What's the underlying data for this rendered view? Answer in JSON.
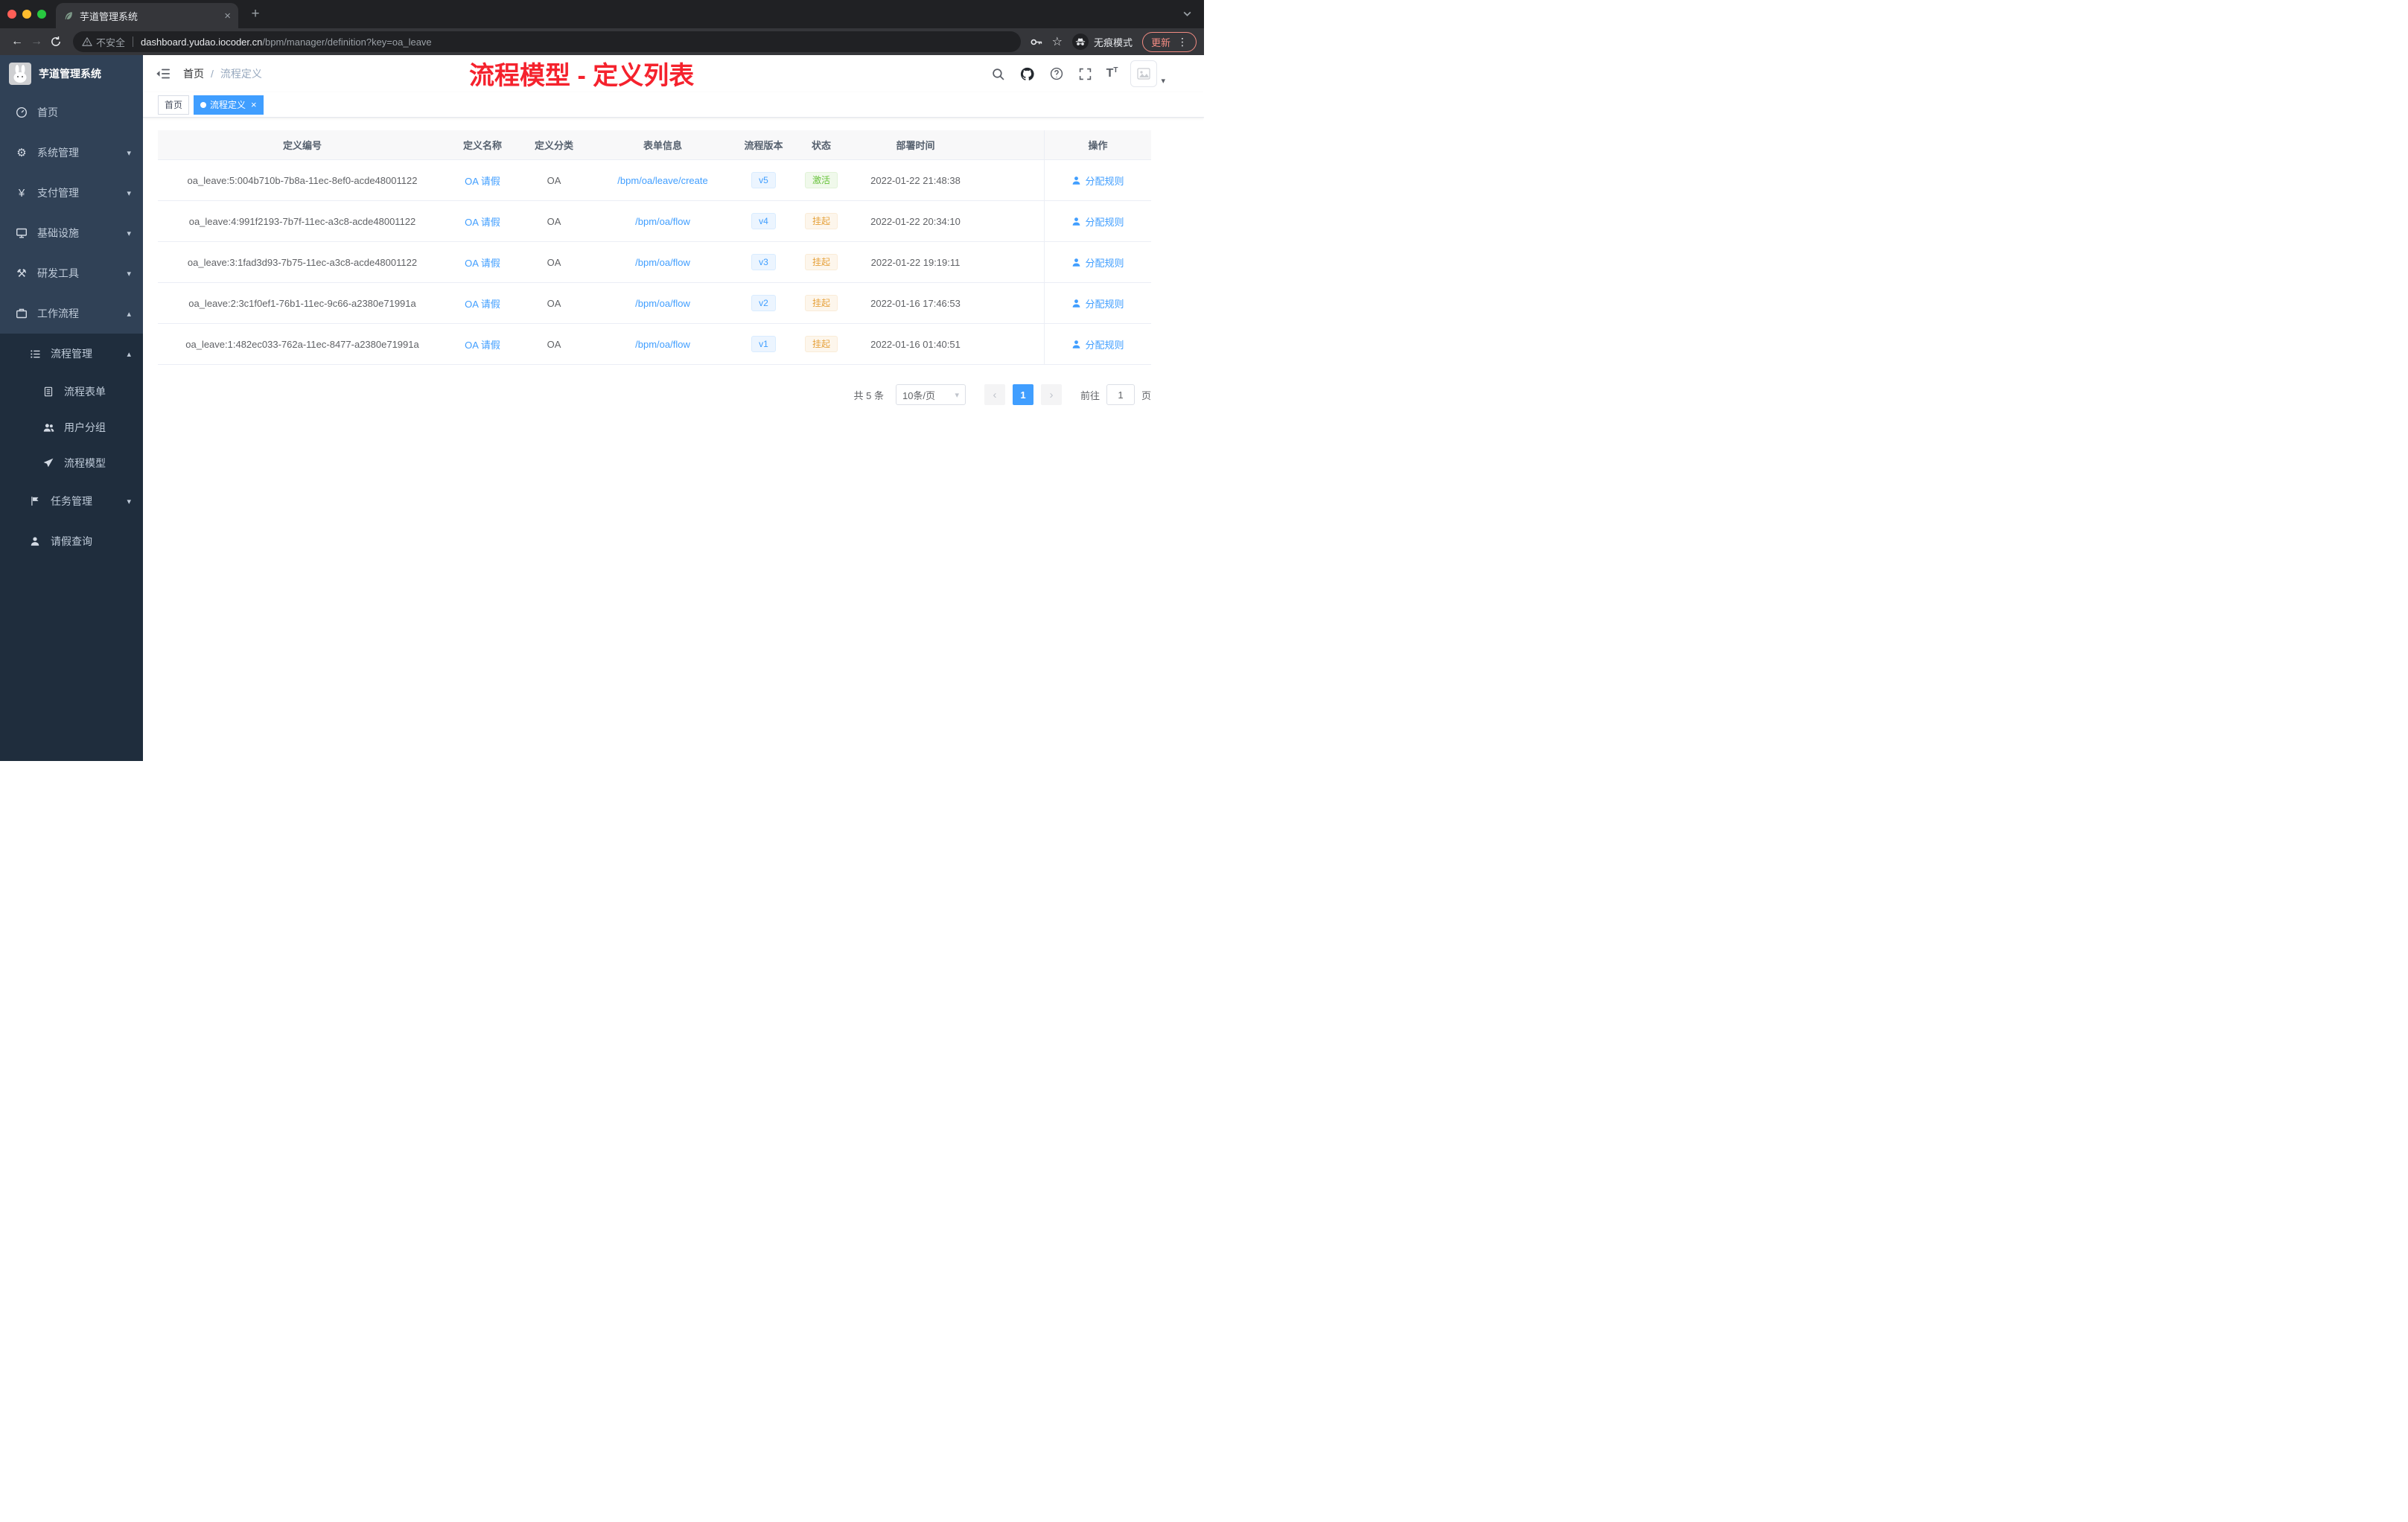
{
  "colors": {
    "accent_blue": "#409eff",
    "success_green": "#67c23a",
    "warning_orange": "#e6a23c",
    "annotation_red": "#f5222d",
    "sidebar_bg": "#304156",
    "sidebar_submenu_bg": "#1f2d3d",
    "active_tag_bg": "#409eff"
  },
  "browser": {
    "tab_title": "芋道管理系统",
    "security_label": "不安全",
    "url_host": "dashboard.yudao.iocoder.cn",
    "url_path": "/bpm/manager/definition?key=oa_leave",
    "incognito_label": "无痕模式",
    "update_label": "更新"
  },
  "sidebar": {
    "logo_title": "芋道管理系统",
    "items": [
      {
        "label": "首页"
      },
      {
        "label": "系统管理"
      },
      {
        "label": "支付管理"
      },
      {
        "label": "基础设施"
      },
      {
        "label": "研发工具"
      },
      {
        "label": "工作流程"
      }
    ],
    "submenu": {
      "process_label": "流程管理",
      "children": [
        {
          "label": "流程表单"
        },
        {
          "label": "用户分组"
        },
        {
          "label": "流程模型"
        }
      ],
      "task_label": "任务管理",
      "leave_label": "请假查询"
    }
  },
  "header": {
    "breadcrumb_home": "首页",
    "breadcrumb_separator": "/",
    "breadcrumb_current": "流程定义",
    "annotation": "流程模型 - 定义列表"
  },
  "tags": {
    "home": "首页",
    "current": "流程定义"
  },
  "table": {
    "columns": [
      "定义编号",
      "定义名称",
      "定义分类",
      "表单信息",
      "流程版本",
      "状态",
      "部署时间",
      "操作"
    ],
    "rows": [
      {
        "id": "oa_leave:5:004b710b-7b8a-11ec-8ef0-acde48001122",
        "name": "OA 请假",
        "category": "OA",
        "form": "/bpm/oa/leave/create",
        "version": "v5",
        "status": "激活",
        "status_type": "success",
        "time": "2022-01-22 21:48:38",
        "action": "分配规则"
      },
      {
        "id": "oa_leave:4:991f2193-7b7f-11ec-a3c8-acde48001122",
        "name": "OA 请假",
        "category": "OA",
        "form": "/bpm/oa/flow",
        "version": "v4",
        "status": "挂起",
        "status_type": "warning",
        "time": "2022-01-22 20:34:10",
        "action": "分配规则"
      },
      {
        "id": "oa_leave:3:1fad3d93-7b75-11ec-a3c8-acde48001122",
        "name": "OA 请假",
        "category": "OA",
        "form": "/bpm/oa/flow",
        "version": "v3",
        "status": "挂起",
        "status_type": "warning",
        "time": "2022-01-22 19:19:11",
        "action": "分配规则"
      },
      {
        "id": "oa_leave:2:3c1f0ef1-76b1-11ec-9c66-a2380e71991a",
        "name": "OA 请假",
        "category": "OA",
        "form": "/bpm/oa/flow",
        "version": "v2",
        "status": "挂起",
        "status_type": "warning",
        "time": "2022-01-16 17:46:53",
        "action": "分配规则"
      },
      {
        "id": "oa_leave:1:482ec033-762a-11ec-8477-a2380e71991a",
        "name": "OA 请假",
        "category": "OA",
        "form": "/bpm/oa/flow",
        "version": "v1",
        "status": "挂起",
        "status_type": "warning",
        "time": "2022-01-16 01:40:51",
        "action": "分配规则"
      }
    ]
  },
  "pagination": {
    "total": "共 5 条",
    "page_size": "10条/页",
    "prev": "‹",
    "current_page": "1",
    "next": "›",
    "goto_label": "前往",
    "goto_value": "1",
    "goto_unit": "页"
  },
  "icons": {
    "back": "←",
    "forward": "→",
    "star": "☆",
    "gear": "⚙",
    "yen": "¥",
    "hammer": "⚒",
    "menu_dots": "⋮",
    "caret_down": "▾",
    "caret_up": "▴",
    "close": "×",
    "plus": "+",
    "font_large": "T",
    "font_small": "T"
  }
}
